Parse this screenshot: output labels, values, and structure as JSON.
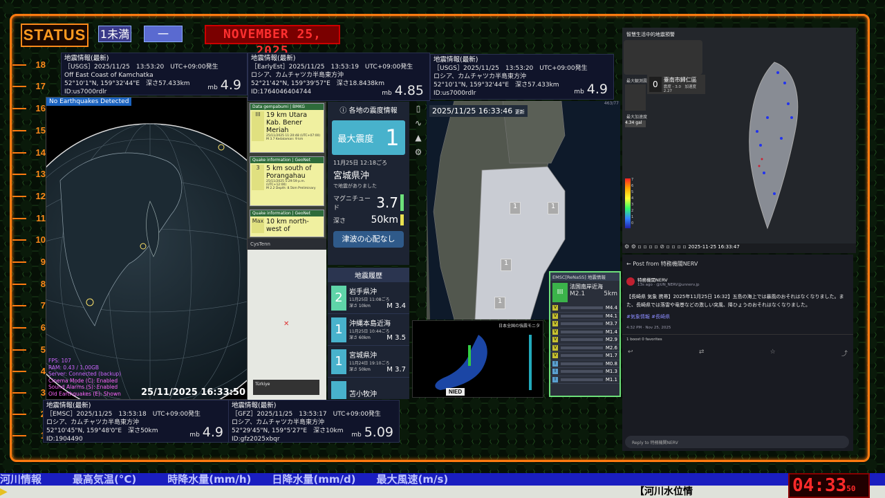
{
  "header": {
    "status": "STATUS",
    "pill1": "1未満",
    "pill2": "一",
    "date": "NOVEMBER 25, 2025"
  },
  "ruler": [
    "18",
    "17",
    "16",
    "15",
    "14",
    "13",
    "12",
    "11",
    "10",
    "9",
    "8",
    "7",
    "6",
    "5",
    "4",
    "3",
    "2",
    "1"
  ],
  "ruler_top": "20",
  "eq_cards": [
    {
      "title": "地震情報(最新)",
      "line1": "［USGS］2025/11/25　13:53:20　UTC+09:00発生",
      "line2": "Off East Coast of Kamchatka",
      "line3": "52°10'1\"N,  159°32'44\"E　深さ57.433km",
      "line4": "ID:us7000rdlr",
      "mb": "mb",
      "mag": "4.9"
    },
    {
      "title": "地震情報(最新)",
      "line1": "［EarlyEst］2025/11/25　13:53:19　UTC+09:00発生",
      "line2": "ロシア、カムチャツカ半島東方沖",
      "line3": "52°21'42\"N,  159°39'57\"E　深さ18.8438km",
      "line4": "ID:1764046404744",
      "mb": "mb",
      "mag": "4.85"
    },
    {
      "title": "地震情報(最新)",
      "line1": "［USGS］2025/11/25　13:53:20　UTC+09:00発生",
      "line2": "ロシア、カムチャツカ半島東方沖",
      "line3": "52°10'1\"N,  159°32'44\"E　深さ57.433km",
      "line4": "ID:us7000rdlr",
      "mb": "mb",
      "mag": "4.9"
    },
    {
      "title": "地震情報(最新)",
      "line1": "［EMSC］2025/11/25　13:53:18　UTC+09:00発生",
      "line2": "ロシア、カムチャツカ半島東方沖",
      "line3": "52°10'45\"N,  159°48'0\"E　深さ50km",
      "line4": "ID:1904490",
      "mb": "mb",
      "mag": "4.9"
    },
    {
      "title": "地震情報(最新)",
      "line1": "［GFZ］2025/11/25　13:53:17　UTC+09:00発生",
      "line2": "ロシア、カムチャツカ半島東方沖",
      "line3": "52°29'45\"N,  159°5'27\"E　深さ10km",
      "line4": "ID:gfz2025xbqr",
      "mb": "mb",
      "mag": "5.09"
    }
  ],
  "globe": {
    "badge": "No Earthquakes Detected",
    "time": "25/11/2025 16:33:50",
    "stats": [
      "FPS: 107",
      "RAM: 0.43 / 1.00GB",
      "Server: Connected (backup)",
      "Cinema Mode (C): Enabled",
      "Sound Alarms (S): Enabled",
      "Old Earthquakes (E): Shown"
    ]
  },
  "bmkg": [
    {
      "head": "Data gempabumi | BMKG",
      "place": "19 km Utara Kab. Bener Meriah",
      "inten": "III",
      "detail": "25/11/2025 11:20:48 (UTC+07:00)",
      "mag": "M 3.7  Kedalaman: 9 km"
    },
    {
      "head": "Quake information | GeoNet",
      "place": "5 km south of Porangahau",
      "inten": "3",
      "detail": "25/11/2025 5:29:59 p.m. (UTC+12:00)",
      "mag": "M 2.2  Depth: 8.5km  Preliminary"
    },
    {
      "head": "Quake information | GeoNet",
      "place": "10 km north-west of",
      "inten": "Max",
      "detail": "",
      "mag": ""
    }
  ],
  "phone": {
    "app": "CysTenn",
    "caption": "Türkiye"
  },
  "jp": {
    "header": "各地の震度情報",
    "maxlabel": "最大震度",
    "maxval": "1",
    "time": "11月25日 12:18ごろ",
    "region": "宮城県沖",
    "note": "で地震がありました",
    "mag_label": "マグニチュード",
    "mag": "3.7",
    "depth_label": "深さ",
    "depth": "50km",
    "tsunami": "津波の心配なし",
    "history": "地震履歴",
    "hist": [
      {
        "i": "2",
        "place": "岩手県沖",
        "time": "11月25日 11:08ごろ",
        "depth": "深さ 10km",
        "mag": "M 3.4"
      },
      {
        "i": "1",
        "place": "沖縄本島近海",
        "time": "11月25日 10:44ごろ",
        "depth": "深さ 60km",
        "mag": "M 3.5"
      },
      {
        "i": "1",
        "place": "宮城県沖",
        "time": "11月24日 19:10ごろ",
        "depth": "深さ 50km",
        "mag": "M 3.7"
      },
      {
        "i": "",
        "place": "苫小牧沖",
        "time": "",
        "depth": "",
        "mag": ""
      }
    ]
  },
  "map": {
    "time": "2025/11/25 16:33:46",
    "update": "更新",
    "markers": [
      "1",
      "1",
      "1",
      "1"
    ],
    "corner": "463/77"
  },
  "nied": {
    "title": "日本全国の強震モニタ",
    "logo": "NIED"
  },
  "emsc": {
    "header": "EMSC[ReNaSS] 地震情報",
    "int": "III",
    "place": "法国南岸近海",
    "mag": "M2.1",
    "depth": "5km",
    "list": [
      {
        "i": "V",
        "m": "M4.4"
      },
      {
        "i": "V",
        "m": "M4.1"
      },
      {
        "i": "V",
        "m": "M3.7"
      },
      {
        "i": "V",
        "m": "M1.4"
      },
      {
        "i": "V",
        "m": "M2.9"
      },
      {
        "i": "V",
        "m": "M2.6"
      },
      {
        "i": "V",
        "m": "M1.7"
      },
      {
        "i": "I",
        "m": "M0.8"
      },
      {
        "i": "I",
        "m": "M1.3"
      },
      {
        "i": "I",
        "m": "M1.1"
      }
    ]
  },
  "taiwan": {
    "title": "智慧生活中的地震預警",
    "level": "0",
    "city": "臺南市歸仁區",
    "vals": "震度 - 3.0　加速度 2.27",
    "leftlab1": "最大観測震度",
    "leftlab2": "最大加速度",
    "leftval": "4.34 gal",
    "ts": "2025-11-25 16:33:47",
    "scale": [
      "7",
      "6",
      "5",
      "4",
      "3",
      "2",
      "1",
      "0"
    ]
  },
  "post": {
    "nav": "Post from 特務機關NERV",
    "name": "特務機関NERV",
    "handle": "13s ago · @UN_NERV@unnerv.jp",
    "text": "【長崎県 気象 携帯】2025年11月25日 16:32】五島の海上では暴風のおそれはなくなりました。また、長崎県では落雷や竜巻などの激しい突風、降ひょうのおそれはなくなりました。",
    "tags": "#気象情報 #長崎県",
    "meta": "4:32 PM · Nov 25, 2025",
    "boosts": "1 boost  0 favorites",
    "reply": "Reply to 特務機関NERV"
  },
  "ticker": {
    "text": "河川情報　　　最高気温(°C)　　　時降水量(mm/h)　　日降水量(mm/d)　　最大風速(m/s)",
    "text2": "【河川水位情",
    "clock": "04:33",
    "sec": "50"
  }
}
